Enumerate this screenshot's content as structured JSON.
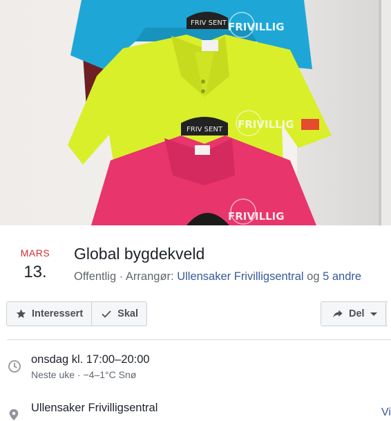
{
  "event": {
    "date": {
      "month": "MARS",
      "day": "13."
    },
    "title": "Global bygdekveld",
    "privacy": "Offentlig",
    "separator": " · ",
    "organizer_label": "Arrangør: ",
    "organizer": "Ullensaker Frivilligsentral",
    "organizer_connector": " og ",
    "others": "5 andre"
  },
  "actions": {
    "interested": "Interessert",
    "going": "Skal",
    "share": "Del"
  },
  "details": {
    "time": "onsdag kl. 17:00–20:00",
    "time_sub": "Neste uke · −4–1°C Snø",
    "location": "Ullensaker Frivilligsentral",
    "location_link_partial": "Vi"
  },
  "cover_photo": {
    "shirt_print_text": "FRIVILLIG",
    "hanger_text": "FRIV SENT",
    "colors": {
      "top": "#1ea7d6",
      "middle": "#d9ef2a",
      "bottom": "#e8356c"
    }
  },
  "colors": {
    "month": "#ce2c2c",
    "link": "#385898",
    "muted": "#606770"
  }
}
